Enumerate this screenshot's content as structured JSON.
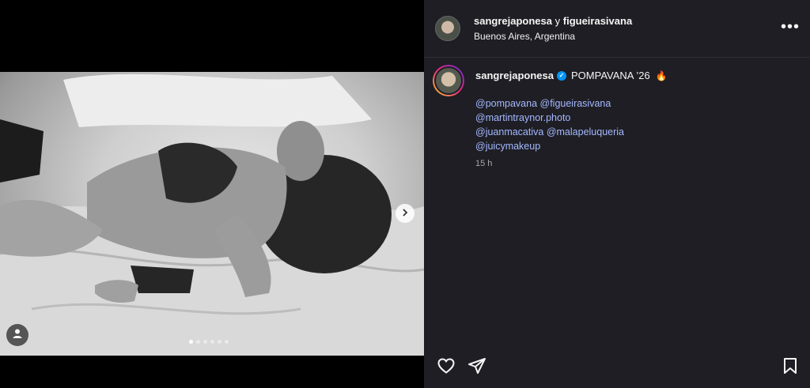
{
  "post": {
    "owner": "sangrejaponesa",
    "owner_sep": "y",
    "collaborator": "figueirasivana",
    "location": "Buenos Aires, Argentina",
    "more_label": "•••"
  },
  "caption": {
    "username": "sangrejaponesa",
    "verified_mark": "✓",
    "text": "POMPAVANA ’26",
    "emoji": "🔥",
    "mentions": [
      [
        "@pompavana",
        "@figueirasivana"
      ],
      [
        "@martintraynor.photo"
      ],
      [
        "@juanmacativa",
        "@malapeluqueria"
      ],
      [
        "@juicymakeup"
      ]
    ],
    "time": "15 h"
  },
  "carousel": {
    "total_dots": 6,
    "active_index": 0
  },
  "icons": {
    "next": "chevron-right-icon",
    "user_tag": "user-icon",
    "like": "heart-icon",
    "share": "send-icon",
    "save": "bookmark-icon"
  },
  "colors": {
    "panel_bg": "#1e1e24",
    "mention": "#a5b9ff",
    "verified": "#0095f6"
  }
}
